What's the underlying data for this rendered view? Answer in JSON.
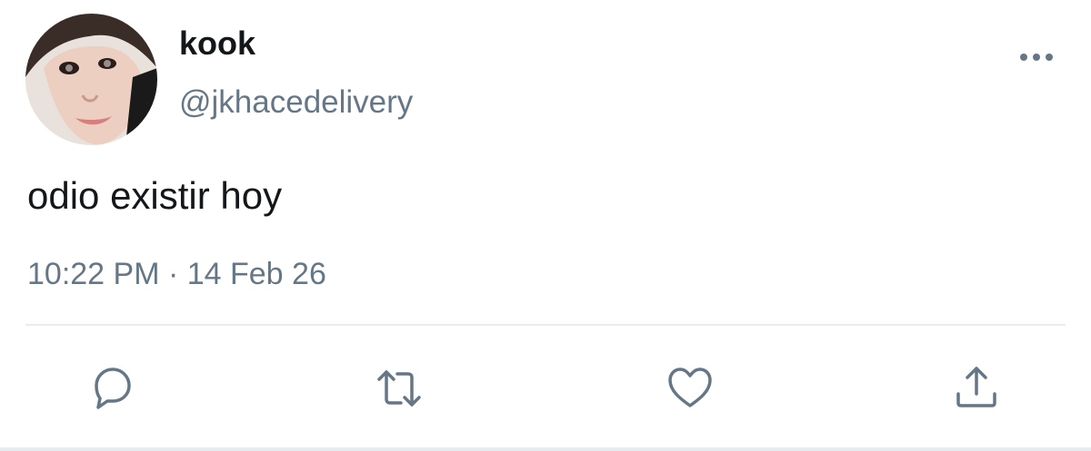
{
  "user": {
    "display_name": "kook",
    "handle": "@jkhacedelivery"
  },
  "tweet": {
    "text": "odio existir hoy",
    "timestamp": "10:22 PM · 14 Feb 26"
  },
  "actions": [
    {
      "icon": "reply-icon"
    },
    {
      "icon": "retweet-icon"
    },
    {
      "icon": "like-icon"
    },
    {
      "icon": "share-icon"
    }
  ],
  "colors": {
    "primary_text": "#14171a",
    "secondary_text": "#657786",
    "divider": "#e6ecf0"
  }
}
